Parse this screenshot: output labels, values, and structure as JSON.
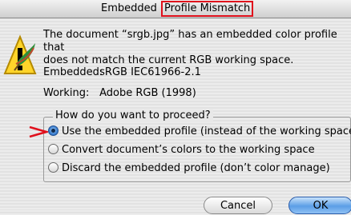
{
  "dialog": {
    "title_prefix": "Embedded",
    "title_highlight": "Profile Mismatch",
    "message_line1": "The document “srgb.jpg” has an embedded color profile that",
    "message_line2": "does not match the current RGB working space.",
    "embedded_label": "Embedded:",
    "embedded_value": "sRGB IEC61966-2.1",
    "working_label": "Working:",
    "working_value": "Adobe RGB (1998)",
    "question": "How do you want to proceed?",
    "options": [
      {
        "label": "Use the embedded profile (instead of the working space)",
        "selected": true
      },
      {
        "label": "Convert document’s colors to the working space",
        "selected": false
      },
      {
        "label": "Discard the embedded profile (don’t color manage)",
        "selected": false
      }
    ],
    "cancel_label": "Cancel",
    "ok_label": "OK"
  },
  "colors": {
    "highlight_box": "#e0101c",
    "arrow": "#e0101c",
    "ok_button": "#5b9ee6"
  },
  "icons": {
    "alert": "warning-triangle-icon",
    "app": "feather-icon"
  }
}
